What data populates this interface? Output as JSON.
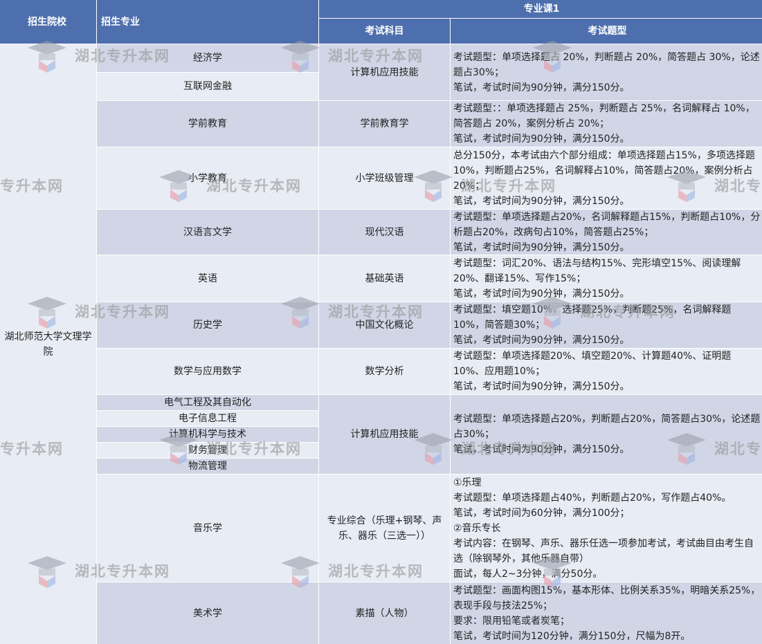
{
  "header": {
    "school": "招生院校",
    "major": "招生专业",
    "group": "专业课1",
    "subject": "考试科目",
    "types": "考试题型"
  },
  "school": "湖北师范大学文理学院",
  "rows": [
    {
      "major": "经济学"
    },
    {
      "major": "互联网金融"
    },
    {
      "major": "学前教育",
      "subject": "学前教育学",
      "types": "考试题型：：单项选择题占 25%，判断题占 25%，名词解释占 10%，简答题占 20%，案例分析占 20%；\n笔试，考试时间为90分钟，满分150分。"
    },
    {
      "major": "小学教育",
      "subject": "小学班级管理",
      "types": "总分150分，本考试由六个部分组成：单项选择题占15%，多项选择题10%，判断题占25%，名词解释占10%，简答题占20%，案例分析占 20%；\n笔试，考试时间为90分钟，满分150分。"
    },
    {
      "major": "汉语言文学",
      "subject": "现代汉语",
      "types": "考试题型：单项选择题占20%，名词解释题占15%，判断题占10%，分析题占20%，改病句占10%，简答题占25%；\n笔试，考试时间为90分钟，满分150分。"
    },
    {
      "major": "英语",
      "subject": "基础英语",
      "types": "考试题型：词汇20%、语法与结构15%、完形填空15%、阅读理解20%、翻译15%、写作15%；\n笔试，考试时间为90分钟，满分150分。"
    },
    {
      "major": "历史学",
      "subject": "中国文化概论",
      "types": "考试题型：填空题10%，选择题25%，判断题25%，名词解释题10%，简答题30%；\n笔试，考试时间为90分钟，满分150分。"
    },
    {
      "major": "数学与应用数学",
      "subject": "数学分析",
      "types": "考试题型：单项选择题20%、填空题20%、计算题40%、证明题10%、应用题10%；\n笔试，考试时间为90分钟，满分150分。"
    },
    {
      "major": "电气工程及其自动化"
    },
    {
      "major": "电子信息工程"
    },
    {
      "major": "计算机科学与技术"
    },
    {
      "major": "财务管理"
    },
    {
      "major": "物流管理"
    },
    {
      "major": "音乐学",
      "subject": "专业综合（乐理+钢琴、声乐、器乐（三选一））",
      "types": "①乐理\n考试题型：单项选择题占40%，判断题占20%，写作题占40%。\n笔试，考试时间为60分钟，满分100分；\n②音乐专长\n考试内容：在钢琴、声乐、器乐任选一项参加考试，考试曲目由考生自选（除钢琴外，其他乐器自带）\n面试，每人2~3分钟，满分50分。"
    },
    {
      "major": "美术学",
      "subject": "素描（人物）",
      "types": "考试题型：画面构图15%，基本形体、比例关系35%，明暗关系25%，表现手段与技法25%；\n要求：限用铅笔或者炭笔；\n笔试，考试时间为120分钟，满分150分，尺幅为8开。"
    }
  ],
  "group1": {
    "subject": "计算机应用技能",
    "types": "考试题型：单项选择题占 20%，判断题占 20%，简答题占 30%，论述题占30%；\n笔试，考试时间为90分钟，满分150分。"
  },
  "group2": {
    "subject": "计算机应用技能",
    "types": "考试题型：单项选择题占20%，判断题占20%，简答题占30%，论述题占30%；\n笔试，考试时间为90分钟，满分150分。"
  },
  "watermark": "湖北专升本网",
  "watermark_partial_a": "专升本网",
  "watermark_partial_b": "湖北专",
  "watermark_partial_c": "湖北专"
}
